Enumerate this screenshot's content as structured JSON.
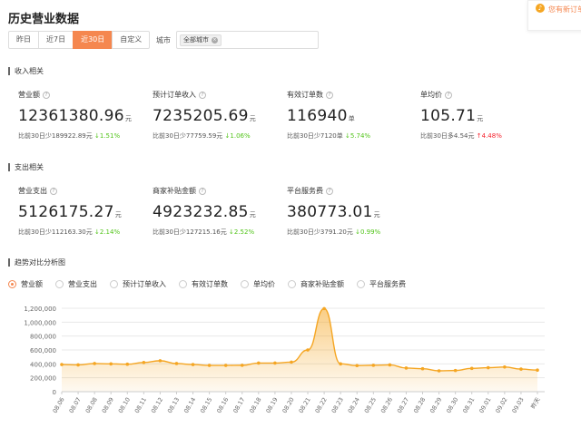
{
  "page": {
    "title": "历史营业数据"
  },
  "tabs": [
    {
      "label": "昨日",
      "active": false
    },
    {
      "label": "近7日",
      "active": false
    },
    {
      "label": "近30日",
      "active": true
    },
    {
      "label": "自定义",
      "active": false
    }
  ],
  "filter": {
    "city_label": "城市",
    "city_tag": "全部城市"
  },
  "notice": {
    "text": "您有新订单"
  },
  "income": {
    "title": "收入相关",
    "metrics": [
      {
        "label": "营业额",
        "value": "12361380.96",
        "unit": "元",
        "compare": "比前30日少189922.89元",
        "change": "1.51%",
        "direction": "down"
      },
      {
        "label": "预计订单收入",
        "value": "7235205.69",
        "unit": "元",
        "compare": "比前30日少77759.59元",
        "change": "1.06%",
        "direction": "down"
      },
      {
        "label": "有效订单数",
        "value": "116940",
        "unit": "单",
        "compare": "比前30日少7120单",
        "change": "5.74%",
        "direction": "down"
      },
      {
        "label": "单均价",
        "value": "105.71",
        "unit": "元",
        "compare": "比前30日多4.54元",
        "change": "4.48%",
        "direction": "up"
      }
    ]
  },
  "expense": {
    "title": "支出相关",
    "metrics": [
      {
        "label": "营业支出",
        "value": "5126175.27",
        "unit": "元",
        "compare": "比前30日少112163.30元",
        "change": "2.14%",
        "direction": "down"
      },
      {
        "label": "商家补贴金额",
        "value": "4923232.85",
        "unit": "元",
        "compare": "比前30日少127215.16元",
        "change": "2.52%",
        "direction": "down"
      },
      {
        "label": "平台服务费",
        "value": "380773.01",
        "unit": "元",
        "compare": "比前30日少3791.20元",
        "change": "0.99%",
        "direction": "down"
      }
    ]
  },
  "trend": {
    "title": "趋势对比分析图",
    "options": [
      {
        "label": "营业额",
        "selected": true
      },
      {
        "label": "营业支出",
        "selected": false
      },
      {
        "label": "预计订单收入",
        "selected": false
      },
      {
        "label": "有效订单数",
        "selected": false
      },
      {
        "label": "单均价",
        "selected": false
      },
      {
        "label": "商家补贴金额",
        "selected": false
      },
      {
        "label": "平台服务费",
        "selected": false
      }
    ]
  },
  "colors": {
    "accent": "#f5874f",
    "line": "#f5a623",
    "down": "#52c41a",
    "up": "#f5222d"
  },
  "icons": {
    "compare_down": "arrow-down",
    "compare_up": "arrow-up",
    "notice": "bell-icon",
    "help": "question-circle-icon"
  },
  "chart_data": {
    "type": "area",
    "x": [
      "08.06",
      "08.07",
      "08.08",
      "08.09",
      "08.10",
      "08.11",
      "08.12",
      "08.13",
      "08.14",
      "08.15",
      "08.16",
      "08.17",
      "08.18",
      "08.19",
      "08.20",
      "08.21",
      "08.22",
      "08.23",
      "08.24",
      "08.25",
      "08.26",
      "08.27",
      "08.28",
      "08.29",
      "08.30",
      "08.31",
      "09.01",
      "09.02",
      "09.03",
      "昨天"
    ],
    "yticks": [
      "0",
      "200,000",
      "400,000",
      "600,000",
      "800,000",
      "1,000,000",
      "1,200,000"
    ],
    "ylim": [
      0,
      1200000
    ],
    "series": [
      {
        "values": [
          390000,
          385000,
          405000,
          400000,
          395000,
          420000,
          445000,
          405000,
          390000,
          378000,
          378000,
          380000,
          412000,
          412000,
          425000,
          600000,
          1195000,
          400000,
          375000,
          380000,
          385000,
          340000,
          330000,
          300000,
          305000,
          335000,
          345000,
          355000,
          325000,
          310000
        ]
      }
    ],
    "grid": true
  }
}
